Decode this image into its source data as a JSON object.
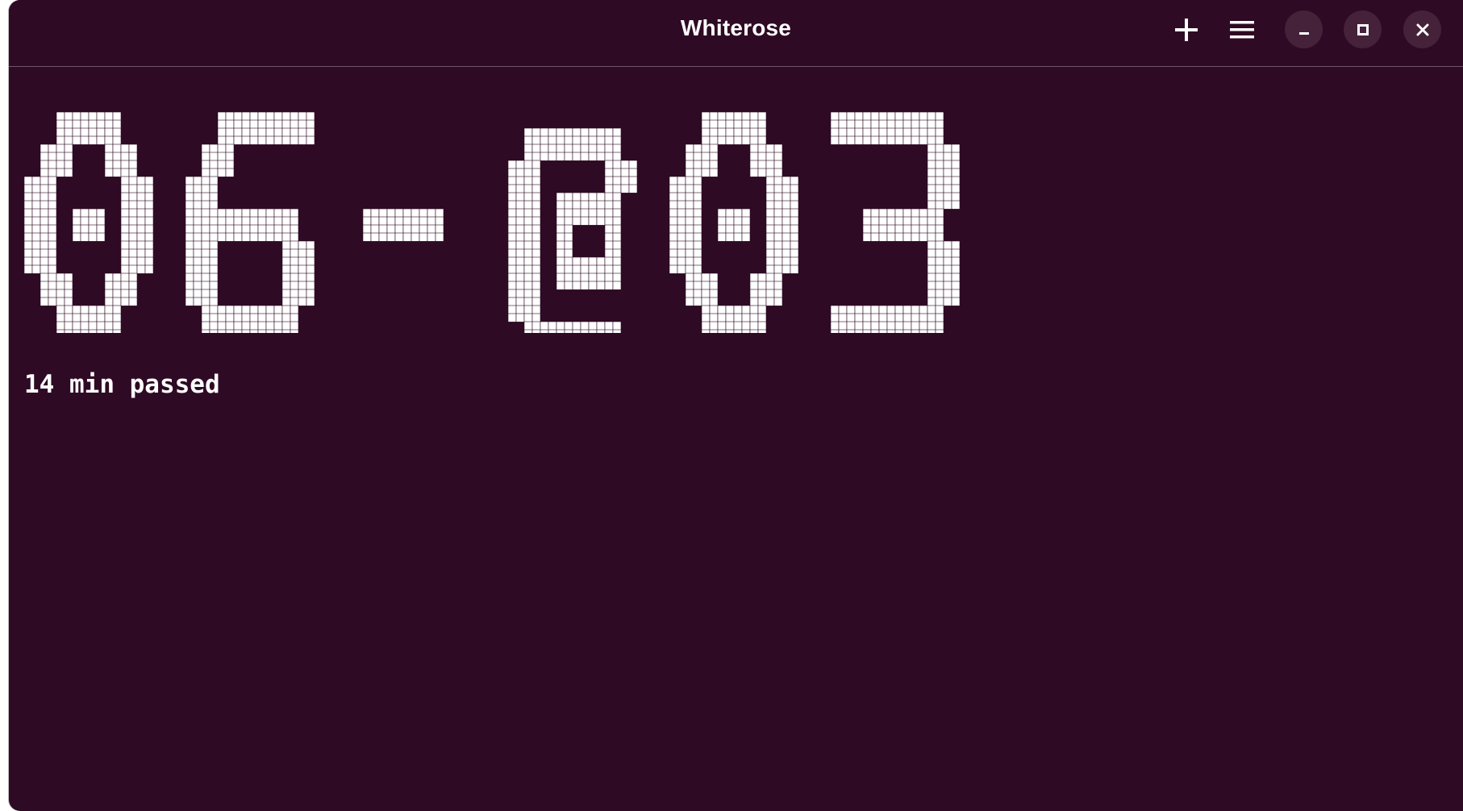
{
  "window": {
    "title": "Whiterose",
    "background": "#2f0a24",
    "buttons": [
      {
        "name": "new-tab-button",
        "icon": "plus-icon"
      },
      {
        "name": "menu-button",
        "icon": "hamburger-icon"
      },
      {
        "name": "minimize-button",
        "icon": "minimize-icon"
      },
      {
        "name": "maximize-button",
        "icon": "maximize-icon"
      },
      {
        "name": "close-button",
        "icon": "close-icon"
      }
    ]
  },
  "terminal": {
    "clock_text": "06-@03",
    "elapsed_text": "14 min passed",
    "foreground": "#ffffff"
  }
}
